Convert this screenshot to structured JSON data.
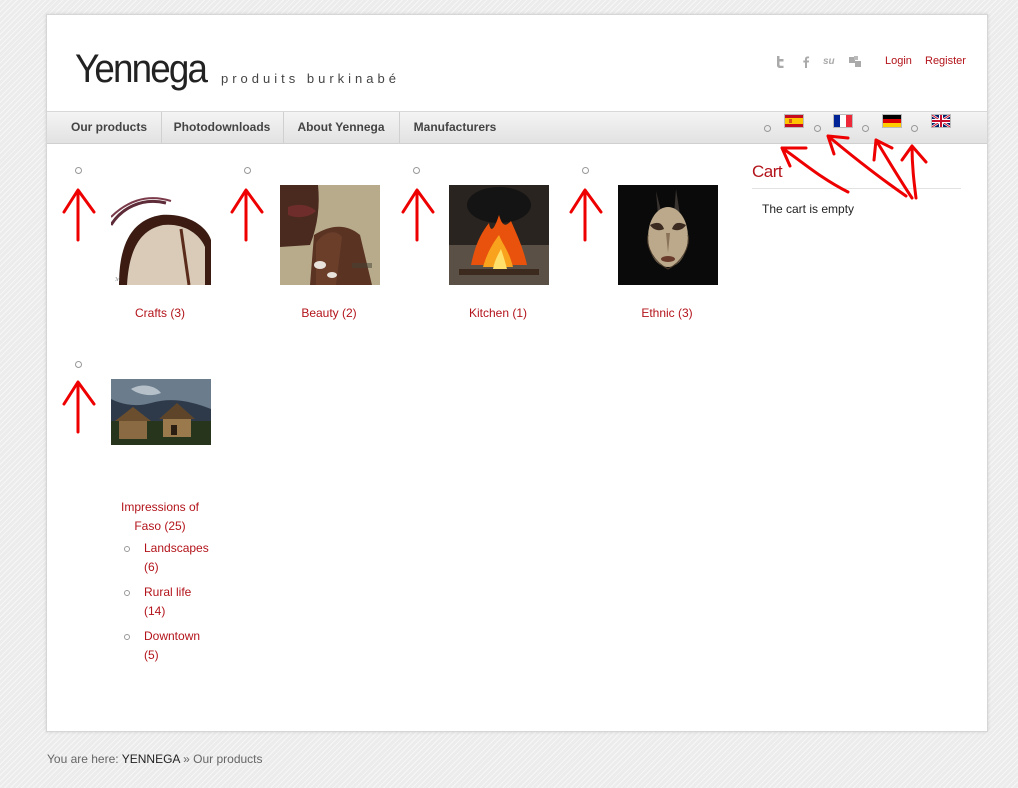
{
  "header": {
    "logo_text": "Yennega",
    "tagline": "produits burkinabé",
    "social_icons": [
      "twitter-icon",
      "facebook-icon",
      "stumbleupon-icon",
      "delicious-icon"
    ],
    "login_label": "Login",
    "register_label": "Register"
  },
  "nav": {
    "items": [
      {
        "label": "Our products"
      },
      {
        "label": "Photodownloads"
      },
      {
        "label": "About Yennega"
      },
      {
        "label": "Manufacturers"
      }
    ],
    "languages": [
      "Spanish",
      "French",
      "German",
      "English"
    ]
  },
  "categories": [
    {
      "label": "Crafts (3)"
    },
    {
      "label": "Beauty (2)"
    },
    {
      "label": "Kitchen (1)"
    },
    {
      "label": "Ethnic (3)"
    },
    {
      "label_line1": "Impressions of",
      "label_line2": "Faso (25)",
      "subcategories": [
        {
          "line1": "Landscapes",
          "line2": "(6)"
        },
        {
          "line1": "Rural life",
          "line2": "(14)"
        },
        {
          "line1": "Downtown",
          "line2": "(5)"
        }
      ]
    }
  ],
  "cart": {
    "title": "Cart",
    "status": "The cart is empty"
  },
  "breadcrumb": {
    "prefix": "You are here:",
    "home": "YENNEGA",
    "separator": "»",
    "current": "Our products"
  },
  "colors": {
    "link_red": "#b3141b",
    "annotation_red": "#ee0000"
  }
}
